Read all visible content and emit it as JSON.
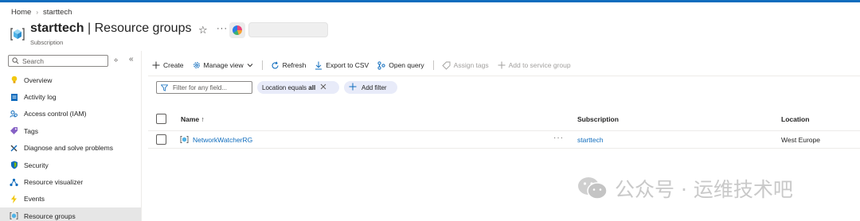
{
  "breadcrumb": {
    "items": [
      "Home",
      "starttech"
    ],
    "separator": "›"
  },
  "header": {
    "title_bold": "starttech",
    "title_rest": " | Resource groups",
    "subtitle": "Subscription",
    "more": "···"
  },
  "sidebar": {
    "search_placeholder": "Search",
    "items": [
      {
        "label": "Overview",
        "icon": "lightbulb-icon"
      },
      {
        "label": "Activity log",
        "icon": "activity-log-icon"
      },
      {
        "label": "Access control (IAM)",
        "icon": "people-icon"
      },
      {
        "label": "Tags",
        "icon": "tag-icon"
      },
      {
        "label": "Diagnose and solve problems",
        "icon": "wrench-icon"
      },
      {
        "label": "Security",
        "icon": "shield-icon"
      },
      {
        "label": "Resource visualizer",
        "icon": "network-icon"
      },
      {
        "label": "Events",
        "icon": "lightning-icon"
      },
      {
        "label": "Resource groups",
        "icon": "resource-group-icon",
        "active": true
      }
    ]
  },
  "toolbar": {
    "create": "Create",
    "manage_view": "Manage view",
    "refresh": "Refresh",
    "export_csv": "Export to CSV",
    "open_query": "Open query",
    "assign_tags": "Assign tags",
    "add_service_group": "Add to service group"
  },
  "filters": {
    "placeholder": "Filter for any field...",
    "location_pill_label": "Location equals ",
    "location_pill_value": "all",
    "add_filter": "Add filter"
  },
  "table": {
    "columns": {
      "name": "Name",
      "sort_indicator": "↑",
      "subscription": "Subscription",
      "location": "Location"
    },
    "rows": [
      {
        "name": "NetworkWatcherRG",
        "subscription": "starttech",
        "location": "West Europe"
      }
    ]
  },
  "watermark": {
    "text": "公众号 · 运维技术吧"
  },
  "colors": {
    "accent": "#0f6cbd",
    "pill_bg": "#e8ebf9",
    "active_nav_bg": "#e6e6e6"
  }
}
